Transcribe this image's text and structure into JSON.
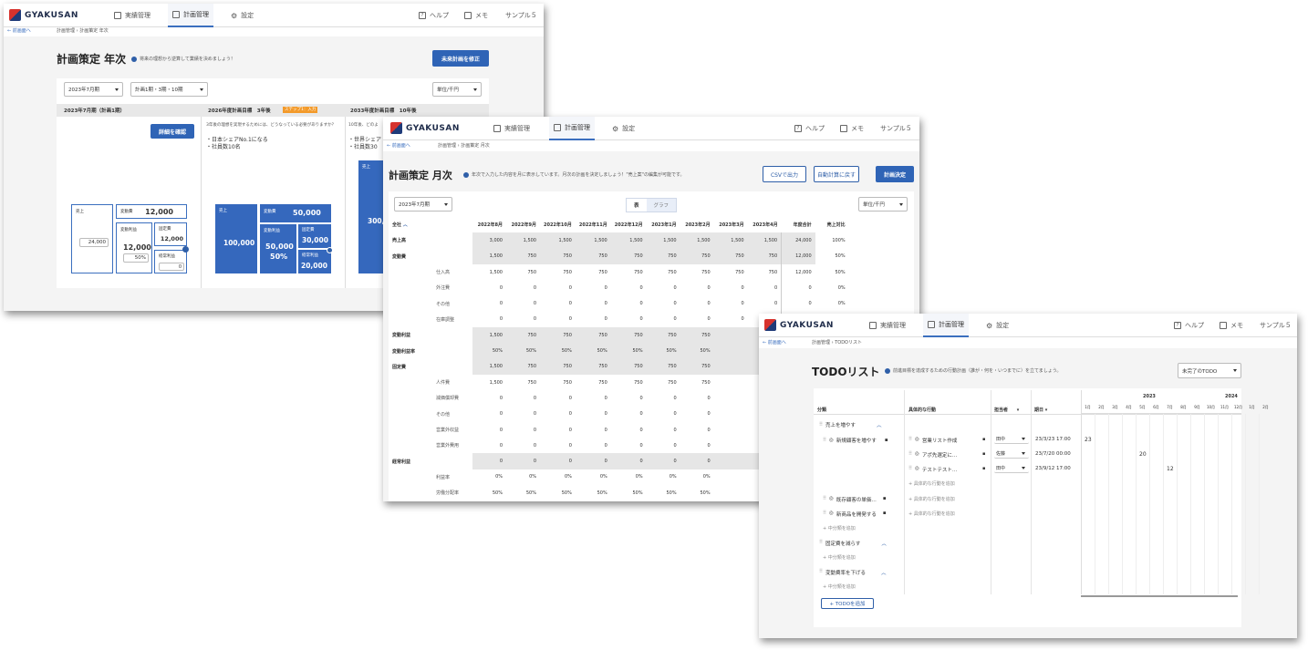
{
  "brand": "GYAKUSAN",
  "nav": {
    "actuals": "実績管理",
    "plans": "計画管理",
    "settings": "設定",
    "help": "ヘルプ",
    "memo": "メモ",
    "sample": "サンプル５"
  },
  "back_label": "← 前画面へ",
  "annual": {
    "breadcrumb_parent": "計画管理",
    "breadcrumb_current": "計画策定 年次",
    "title": "計画策定 年次",
    "hint": "将来の理想から逆算して業績を決めましょう！",
    "fix_future_btn": "未来計画を修正",
    "period_select": "2023年7月期",
    "term_select": "計画1期・3期・10期",
    "unit_select": "単位/千円",
    "col1_header": "2023年7月期（計画1期）",
    "col2_header": "2026年度計画目標　3年後",
    "col2_badge": "ステップ1：入力",
    "col2_question": "3年後の理想を実現するためには、どうなっている必要がありますか？",
    "col2_goals": [
      "・日本シェアNo.1になる",
      "・社員数10名"
    ],
    "col3_header": "2033年度計画目標　10年後",
    "col3_badge": "ステップ1：入力",
    "col3_question": "10年後、どのよ",
    "col3_goals": [
      "・世界シェア",
      "・社員数30"
    ],
    "detail_btn": "詳細を確認",
    "y1": {
      "sales_label": "売上",
      "sales_value": "24,000",
      "var_cost_label": "変動費",
      "var_cost_value": "12,000",
      "var_profit_label": "変動利益",
      "var_profit_value": "12,000",
      "var_profit_rate": "50%",
      "fixed_label": "固定費",
      "fixed_value": "12,000",
      "ord_profit_label": "経常利益",
      "ord_profit_value": "0"
    },
    "y3": {
      "sales_label": "売上",
      "sales_value": "100,000",
      "var_cost_label": "変動費",
      "var_cost_value": "50,000",
      "var_profit_label": "変動利益",
      "var_profit_value": "50,000",
      "var_profit_rate": "50%",
      "fixed_label": "固定費",
      "fixed_value": "30,000",
      "ord_profit_label": "経常利益",
      "ord_profit_value": "20,000"
    },
    "y10": {
      "sales_label": "売上",
      "sales_value": "300,"
    }
  },
  "monthly": {
    "breadcrumb_parent": "計画管理",
    "breadcrumb_current": "計画策定 月次",
    "title": "計画策定 月次",
    "hint": "年次で入力した内容を月に表示しています。月次の計画を決定しましょう！\"売上案\"の編集が可能です。",
    "csv_btn": "CSVで出力",
    "auto_btn": "自動計算に戻す",
    "decide_btn": "計画決定",
    "period_select": "2023年7月期",
    "view_table": "表",
    "view_graph": "グラフ",
    "unit_select": "単位/千円",
    "all_label": "全社",
    "months": [
      "2022年8月",
      "2022年9月",
      "2022年10月",
      "2022年11月",
      "2022年12月",
      "2023年1月",
      "2023年2月",
      "2023年3月",
      "2023年4月"
    ],
    "total_header": "年度合計",
    "ratio_header": "売上対比",
    "rows": [
      {
        "label": "売上高",
        "sub": "",
        "shaded": true,
        "values": [
          "3,000",
          "1,500",
          "1,500",
          "1,500",
          "1,500",
          "1,500",
          "1,500",
          "1,500",
          "1,500"
        ],
        "total": "24,000",
        "ratio": "100%"
      },
      {
        "label": "変動費",
        "sub": "",
        "shaded": true,
        "values": [
          "1,500",
          "750",
          "750",
          "750",
          "750",
          "750",
          "750",
          "750",
          "750"
        ],
        "total": "12,000",
        "ratio": "50%"
      },
      {
        "label": "",
        "sub": "仕入高",
        "shaded": false,
        "values": [
          "1,500",
          "750",
          "750",
          "750",
          "750",
          "750",
          "750",
          "750",
          "750"
        ],
        "total": "12,000",
        "ratio": "50%"
      },
      {
        "label": "",
        "sub": "外注費",
        "shaded": false,
        "values": [
          "0",
          "0",
          "0",
          "0",
          "0",
          "0",
          "0",
          "0",
          "0"
        ],
        "total": "0",
        "ratio": "0%"
      },
      {
        "label": "",
        "sub": "その他",
        "shaded": false,
        "values": [
          "0",
          "0",
          "0",
          "0",
          "0",
          "0",
          "0",
          "0",
          "0"
        ],
        "total": "0",
        "ratio": "0%"
      },
      {
        "label": "",
        "sub": "在庫調整",
        "shaded": false,
        "values": [
          "0",
          "0",
          "0",
          "0",
          "0",
          "0",
          "0",
          "0",
          "0"
        ],
        "total": "0",
        "ratio": "0%"
      },
      {
        "label": "変動利益",
        "sub": "",
        "shaded": true,
        "values": [
          "1,500",
          "750",
          "750",
          "750",
          "750",
          "750",
          "750",
          "",
          ""
        ],
        "total": "",
        "ratio": ""
      },
      {
        "label": "変動利益率",
        "sub": "",
        "shaded": true,
        "values": [
          "50%",
          "50%",
          "50%",
          "50%",
          "50%",
          "50%",
          "50%",
          "",
          ""
        ],
        "total": "",
        "ratio": ""
      },
      {
        "label": "固定費",
        "sub": "",
        "shaded": true,
        "values": [
          "1,500",
          "750",
          "750",
          "750",
          "750",
          "750",
          "750",
          "",
          ""
        ],
        "total": "",
        "ratio": ""
      },
      {
        "label": "",
        "sub": "人件費",
        "shaded": false,
        "values": [
          "1,500",
          "750",
          "750",
          "750",
          "750",
          "750",
          "750",
          "",
          ""
        ],
        "total": "",
        "ratio": ""
      },
      {
        "label": "",
        "sub": "減価償却費",
        "shaded": false,
        "values": [
          "0",
          "0",
          "0",
          "0",
          "0",
          "0",
          "0",
          "",
          ""
        ],
        "total": "",
        "ratio": ""
      },
      {
        "label": "",
        "sub": "その他",
        "shaded": false,
        "values": [
          "0",
          "0",
          "0",
          "0",
          "0",
          "0",
          "0",
          "",
          ""
        ],
        "total": "",
        "ratio": ""
      },
      {
        "label": "",
        "sub": "営業外収益",
        "shaded": false,
        "values": [
          "0",
          "0",
          "0",
          "0",
          "0",
          "0",
          "0",
          "",
          ""
        ],
        "total": "",
        "ratio": ""
      },
      {
        "label": "",
        "sub": "営業外費用",
        "shaded": false,
        "values": [
          "0",
          "0",
          "0",
          "0",
          "0",
          "0",
          "0",
          "",
          ""
        ],
        "total": "",
        "ratio": ""
      },
      {
        "label": "経常利益",
        "sub": "",
        "shaded": true,
        "values": [
          "0",
          "0",
          "0",
          "0",
          "0",
          "0",
          "0",
          "",
          ""
        ],
        "total": "",
        "ratio": ""
      },
      {
        "label": "",
        "sub": "利益率",
        "shaded": false,
        "values": [
          "0%",
          "0%",
          "0%",
          "0%",
          "0%",
          "0%",
          "0%",
          "",
          ""
        ],
        "total": "",
        "ratio": ""
      },
      {
        "label": "",
        "sub": "労働分配率",
        "shaded": false,
        "values": [
          "50%",
          "50%",
          "50%",
          "50%",
          "50%",
          "50%",
          "50%",
          "",
          ""
        ],
        "total": "",
        "ratio": ""
      }
    ]
  },
  "todo": {
    "breadcrumb_parent": "計画管理",
    "breadcrumb_current": "TODOリスト",
    "title": "TODOリスト",
    "hint": "前進目標を達成するための行動計画（誰が・何を・いつまでに）を立てましょう。",
    "filter_select": "未完了のTODO",
    "col_category": "分類",
    "col_action": "具体的な行動",
    "col_owner": "担当者",
    "col_due": "期日",
    "year_2023": "2023",
    "year_2024": "2024",
    "months": [
      "1月",
      "2月",
      "3月",
      "4月",
      "5月",
      "6月",
      "7月",
      "8月",
      "9月",
      "10月",
      "11月",
      "12月",
      "1月",
      "2月"
    ],
    "cat1": "売上を増やす",
    "sub1": "新規顧客を増やす",
    "actions": [
      {
        "text": "営業リスト作成",
        "owner": "田中",
        "due": "23/3/23 17:00",
        "mark": "23"
      },
      {
        "text": "アポ先選定に…",
        "owner": "佐藤",
        "due": "23/7/20 00:00",
        "mark": "20"
      },
      {
        "text": "テストテスト…",
        "owner": "田中",
        "due": "23/9/12 17:00",
        "mark": "12"
      }
    ],
    "add_action": "+ 具体的な行動を追加",
    "sub2": "既存顧客の単価…",
    "sub3": "新商品を開発する",
    "add_sub": "+ 中分類を追加",
    "cat2": "固定費を減らす",
    "cat3": "変動費率を下げる",
    "add_todo_btn": "+ TODOを追加"
  }
}
